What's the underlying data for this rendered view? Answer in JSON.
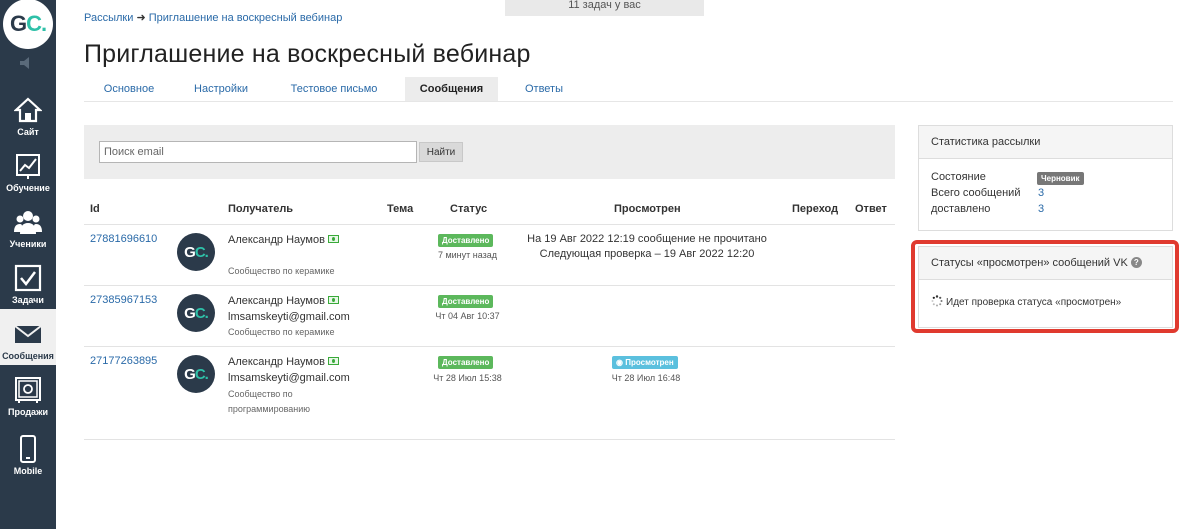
{
  "header": {
    "tasks_notice": "11 задач у вас",
    "breadcrumb_root": "Рассылки",
    "breadcrumb_arrow": "➜",
    "breadcrumb_current": "Приглашение на воскресный вебинар",
    "title": "Приглашение на воскресный вебинар"
  },
  "sidebar": {
    "logo_g": "G",
    "logo_c": "C.",
    "items": [
      {
        "label": "Сайт",
        "icon": "home-icon"
      },
      {
        "label": "Обучение",
        "icon": "chart-icon"
      },
      {
        "label": "Ученики",
        "icon": "users-icon"
      },
      {
        "label": "Задачи",
        "icon": "checkbox-icon"
      },
      {
        "label": "Сообщения",
        "icon": "envelope-icon"
      },
      {
        "label": "Продажи",
        "icon": "safe-icon"
      },
      {
        "label": "Mobile",
        "icon": "phone-icon"
      }
    ]
  },
  "tabs": [
    {
      "label": "Основное"
    },
    {
      "label": "Настройки"
    },
    {
      "label": "Тестовое письмо"
    },
    {
      "label": "Сообщения"
    },
    {
      "label": "Ответы"
    }
  ],
  "search": {
    "placeholder": "Поиск email",
    "button": "Найти"
  },
  "table": {
    "headers": {
      "id": "Id",
      "recipient": "Получатель",
      "subject": "Тема",
      "status": "Статус",
      "viewed": "Просмотрен",
      "click": "Переход",
      "reply": "Ответ"
    },
    "rows": [
      {
        "id": "27881696610",
        "name": "Александр Наумов",
        "email": "",
        "community": "Сообщество по керамике",
        "community2": "",
        "status": "Доставлено",
        "status_time": "7 минут назад",
        "viewed_line1": "На 19 Авг 2022 12:19 сообщение не прочитано",
        "viewed_line2": "Следующая проверка – 19 Авг 2022 12:20"
      },
      {
        "id": "27385967153",
        "name": "Александр Наумов",
        "email": "lmsamskeyti@gmail.com",
        "community": "Сообщество по керамике",
        "community2": "",
        "status": "Доставлено",
        "status_time": "Чт 04 Авг 10:37"
      },
      {
        "id": "27177263895",
        "name": "Александр Наумов",
        "email": "lmsamskeyti@gmail.com",
        "community": "Сообщество по",
        "community2": "программированию",
        "status": "Доставлено",
        "status_time": "Чт 28 Июл 15:38",
        "viewed_badge": "Просмотрен",
        "viewed_time": "Чт 28 Июл 16:48"
      }
    ]
  },
  "stats": {
    "title": "Статистика рассылки",
    "state_label": "Состояние",
    "state_value": "Черновик",
    "total_label": "Всего сообщений",
    "total_value": "3",
    "delivered_label": "доставлено",
    "delivered_value": "3"
  },
  "vk": {
    "title": "Статусы «просмотрен» сообщений VK",
    "help": "?",
    "checking": "Идет проверка статуса «просмотрен»"
  },
  "colors": {
    "sidebar": "#2b3a4a",
    "accent": "#2ec0a8",
    "link": "#2a6aa8",
    "delivered": "#5cb85c",
    "viewed": "#5bc0de",
    "highlight": "#e03a2f"
  }
}
